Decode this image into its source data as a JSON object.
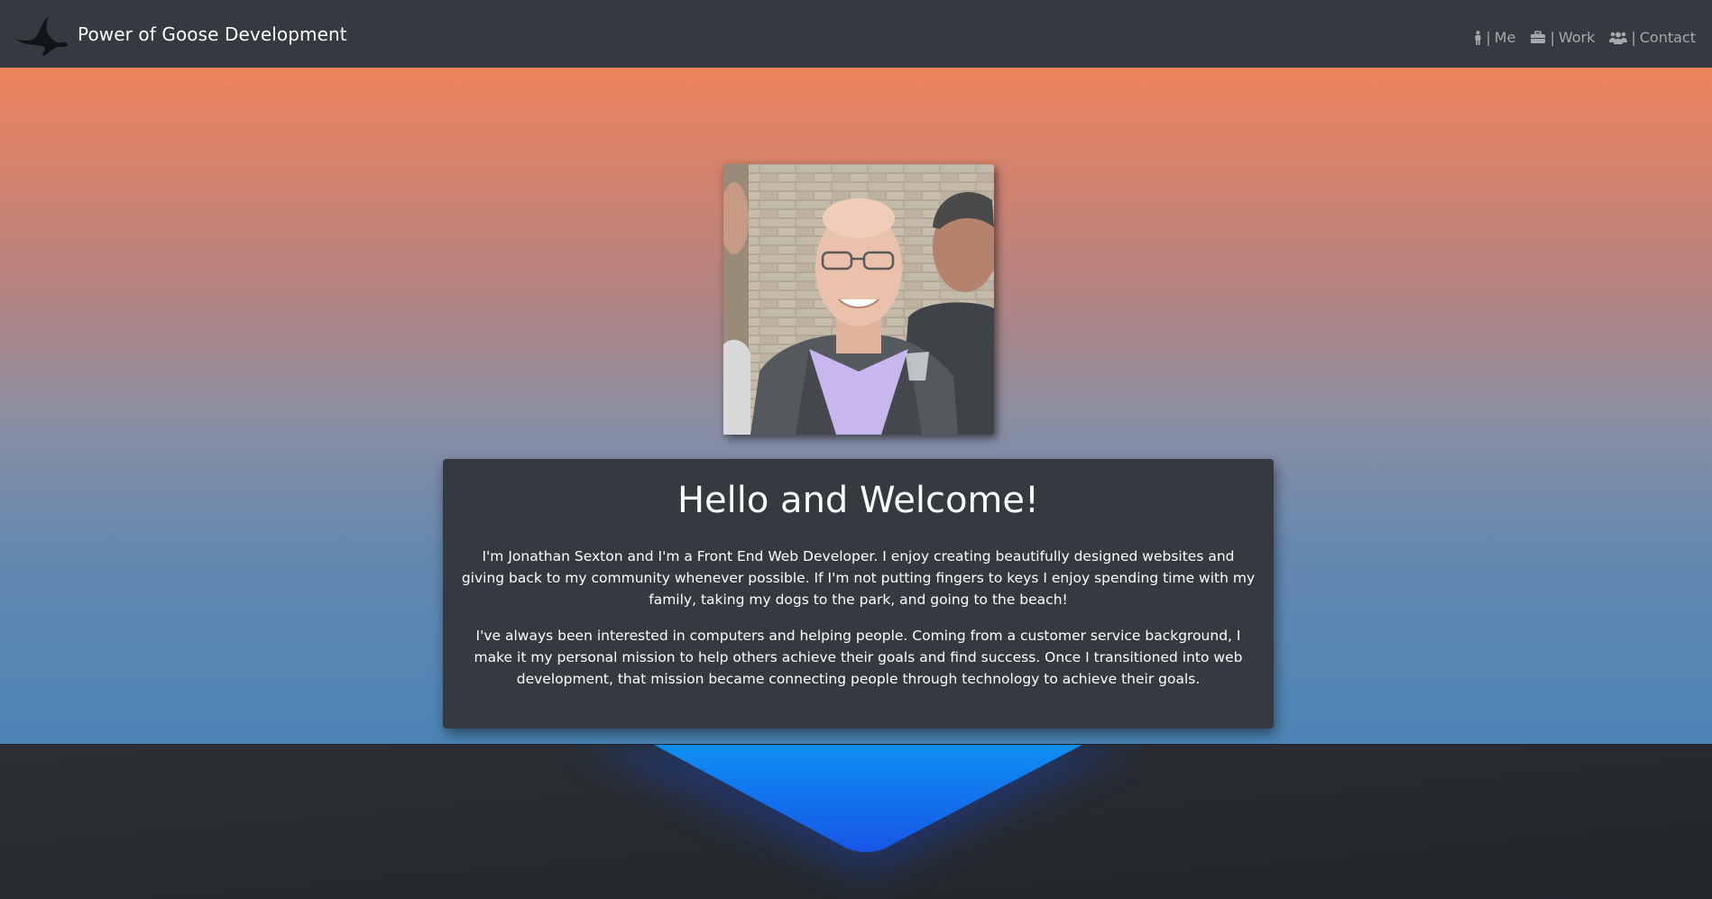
{
  "navbar": {
    "brand_name": "Power of Goose Development",
    "logo_icon": "goose-silhouette-icon",
    "links": [
      {
        "icon": "person-icon",
        "separator": "|",
        "label": "Me"
      },
      {
        "icon": "briefcase-icon",
        "separator": "|",
        "label": "Work"
      },
      {
        "icon": "users-icon",
        "separator": "|",
        "label": "Contact"
      }
    ]
  },
  "hero": {
    "portrait_alt": "photo",
    "title": "Hello and Welcome!",
    "paragraphs": [
      "I'm Jonathan Sexton and I'm a Front End Web Developer. I enjoy creating beautifully designed websites and giving back to my community whenever possible. If I'm not putting fingers to keys I enjoy spending time with my family, taking my dogs to the park, and going to the beach!",
      "I've always been interested in computers and helping people. Coming from a customer service background, I make it my personal mission to help others achieve their goals and find success. Once I transitioned into web development, that mission became connecting people through technology to achieve their goals."
    ]
  },
  "colors": {
    "navbar_bg": "#343a40",
    "card_bg": "#343a40",
    "gradient_top": "#ee835b",
    "gradient_bottom": "#4c84b6",
    "footer_accent": "#1e7bf0"
  }
}
